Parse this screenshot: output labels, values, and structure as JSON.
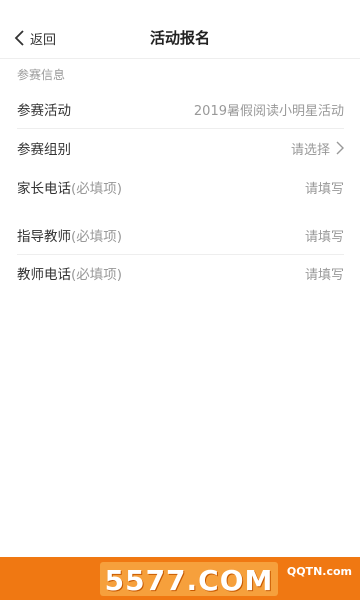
{
  "nav": {
    "back_label": "返回",
    "title": "活动报名"
  },
  "section": {
    "label": "参赛信息"
  },
  "form": {
    "rows": [
      {
        "label": "参赛活动",
        "hint": "",
        "value": "2019暑假阅读小明星活动"
      },
      {
        "label": "参赛组别",
        "hint": "",
        "value": "请选择"
      },
      {
        "label": "家长电话",
        "hint": "(必填项)",
        "value": "请填写"
      },
      {
        "label": "指导教师",
        "hint": "(必填项)",
        "value": "请填写"
      },
      {
        "label": "教师电话",
        "hint": "(必填项)",
        "value": "请填写"
      }
    ]
  },
  "banner": {
    "text": "5577.COM",
    "logo": "QQTN.com"
  },
  "colors": {
    "banner_bg": "#f07812",
    "divider": "#eeeeee",
    "muted_text": "#999999"
  }
}
